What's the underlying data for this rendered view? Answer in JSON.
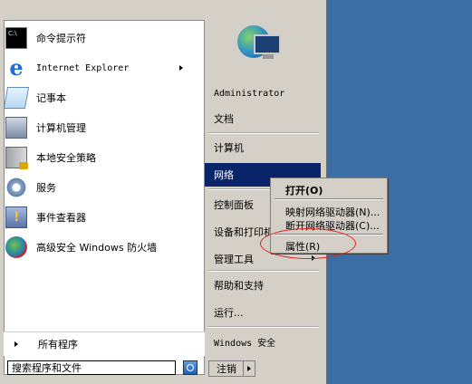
{
  "left_items": [
    {
      "label": "命令提示符",
      "icon": "command-prompt-icon"
    },
    {
      "label": "Internet Explorer",
      "icon": "internet-explorer-icon"
    },
    {
      "label": "记事本",
      "icon": "notepad-icon"
    },
    {
      "label": "计算机管理",
      "icon": "computer-management-icon"
    },
    {
      "label": "本地安全策略",
      "icon": "local-security-policy-icon"
    },
    {
      "label": "服务",
      "icon": "services-gear-icon"
    },
    {
      "label": "事件查看器",
      "icon": "event-viewer-icon"
    },
    {
      "label": "高级安全 Windows 防火墙",
      "icon": "firewall-icon"
    }
  ],
  "all_programs": "所有程序",
  "search": {
    "value": "搜索程序和文件"
  },
  "right_items": {
    "user": "Administrator",
    "documents": "文档",
    "computer": "计算机",
    "network": "网络",
    "control_panel": "控制面板",
    "devices_printers": "设备和打印机",
    "admin_tools": "管理工具",
    "help": "帮助和支持",
    "run": "运行...",
    "windows_security": "Windows 安全"
  },
  "logoff": "注销",
  "context_menu": {
    "open": "打开(O)",
    "map_drive": "映射网络驱动器(N)...",
    "disconnect_drive": "断开网络驱动器(C)...",
    "properties": "属性(R)"
  },
  "colors": {
    "highlight": "#0a246a",
    "annotation": "#e02020",
    "desktop": "#3a6ea5"
  }
}
